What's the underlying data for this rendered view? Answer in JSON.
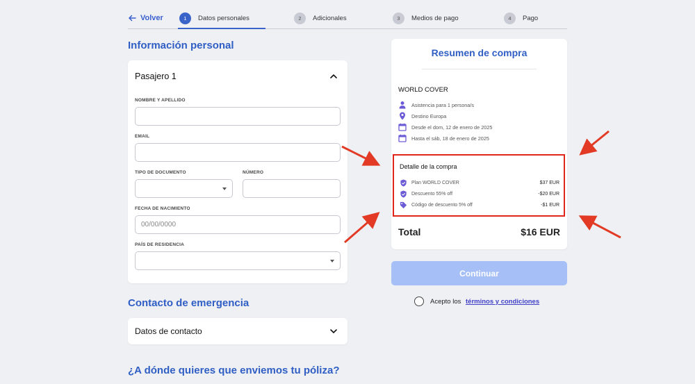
{
  "nav": {
    "back_label": "Volver",
    "steps": [
      {
        "num": "1",
        "label": "Datos personales"
      },
      {
        "num": "2",
        "label": "Adicionales"
      },
      {
        "num": "3",
        "label": "Medios de pago"
      },
      {
        "num": "4",
        "label": "Pago"
      }
    ],
    "active_step": 1
  },
  "personal": {
    "title": "Información personal",
    "passenger_title": "Pasajero 1",
    "fields": {
      "name_label": "NOMBRE Y APELLIDO",
      "email_label": "EMAIL",
      "doc_type_label": "TIPO DE DOCUMENTO",
      "number_label": "NÚMERO",
      "birth_label": "FECHA DE NACIMIENTO",
      "birth_placeholder": "00/00/0000",
      "country_label": "PAÍS DE RESIDENCIA"
    }
  },
  "emergency": {
    "title": "Contacto de emergencia",
    "contact_title": "Datos de contacto"
  },
  "delivery": {
    "title": "¿A dónde quieres que enviemos tu póliza?"
  },
  "summary": {
    "title": "Resumen de compra",
    "product": "WORLD COVER",
    "info": [
      {
        "icon": "person-icon",
        "text": "Asistencia para 1 persona/s"
      },
      {
        "icon": "location-pin-icon",
        "text": "Destino Europa"
      },
      {
        "icon": "calendar-icon",
        "text": "Desde el dom, 12 de enero de 2025"
      },
      {
        "icon": "calendar-icon",
        "text": "Hasta el sáb, 18 de enero de 2025"
      }
    ],
    "detail_title": "Detalle de la compra",
    "lines": [
      {
        "icon": "shield-check-icon",
        "label": "Plan WORLD COVER",
        "value": "$37 EUR"
      },
      {
        "icon": "shield-check-icon",
        "label": "Descuento 55% off",
        "value": "-$20 EUR"
      },
      {
        "icon": "tag-icon",
        "label": "Código de descuento 5% off",
        "value": "-$1 EUR"
      }
    ],
    "total_label": "Total",
    "total_value": "$16 EUR"
  },
  "actions": {
    "continue_label": "Continuar",
    "terms_prefix": "Acepto los",
    "terms_link": "términos y condiciones"
  },
  "colors": {
    "accent": "#2f5ec4",
    "highlight": "#e0251b",
    "button_disabled": "#a6bff7"
  }
}
